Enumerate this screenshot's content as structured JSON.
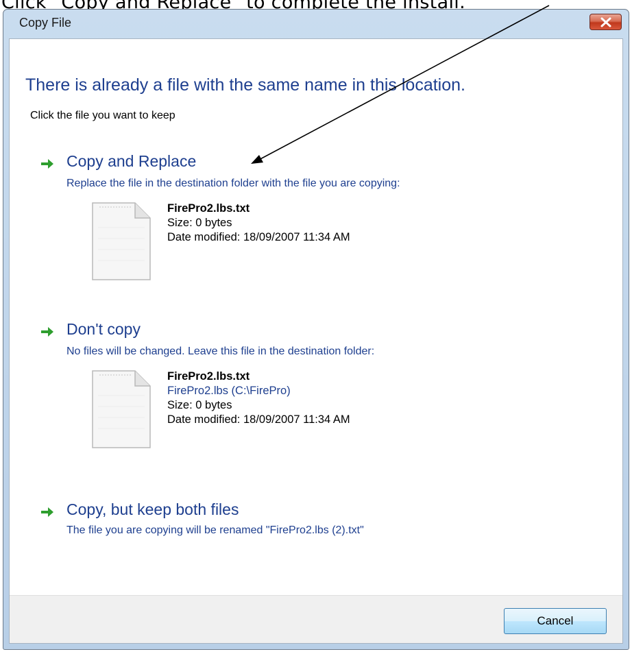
{
  "instruction": "Click \"Copy and Replace\" to complete the install.",
  "window": {
    "title": "Copy File",
    "heading": "There is already a file with the same name in this location.",
    "subtitle": "Click the file you want to keep"
  },
  "options": {
    "copy_replace": {
      "title": "Copy and Replace",
      "description": "Replace the file in the destination folder with the file you are copying:",
      "file": {
        "name": "FirePro2.lbs.txt",
        "size": "Size: 0 bytes",
        "date": "Date modified: 18/09/2007 11:34 AM"
      }
    },
    "dont_copy": {
      "title": "Don't copy",
      "description": "No files will be changed. Leave this file in the destination folder:",
      "file": {
        "name": "FirePro2.lbs.txt",
        "location": "FirePro2.lbs (C:\\FirePro)",
        "size": "Size: 0 bytes",
        "date": "Date modified: 18/09/2007 11:34 AM"
      }
    },
    "keep_both": {
      "title": "Copy, but keep both files",
      "description": "The file you are copying will be renamed \"FirePro2.lbs (2).txt\""
    }
  },
  "footer": {
    "cancel_label": "Cancel"
  },
  "colors": {
    "link_blue": "#1e3f8f",
    "arrow_green": "#2e9e2e",
    "close_red": "#c0391d"
  },
  "icons": [
    "close-icon",
    "green-arrow-icon",
    "text-file-icon",
    "pointer-arrow"
  ]
}
